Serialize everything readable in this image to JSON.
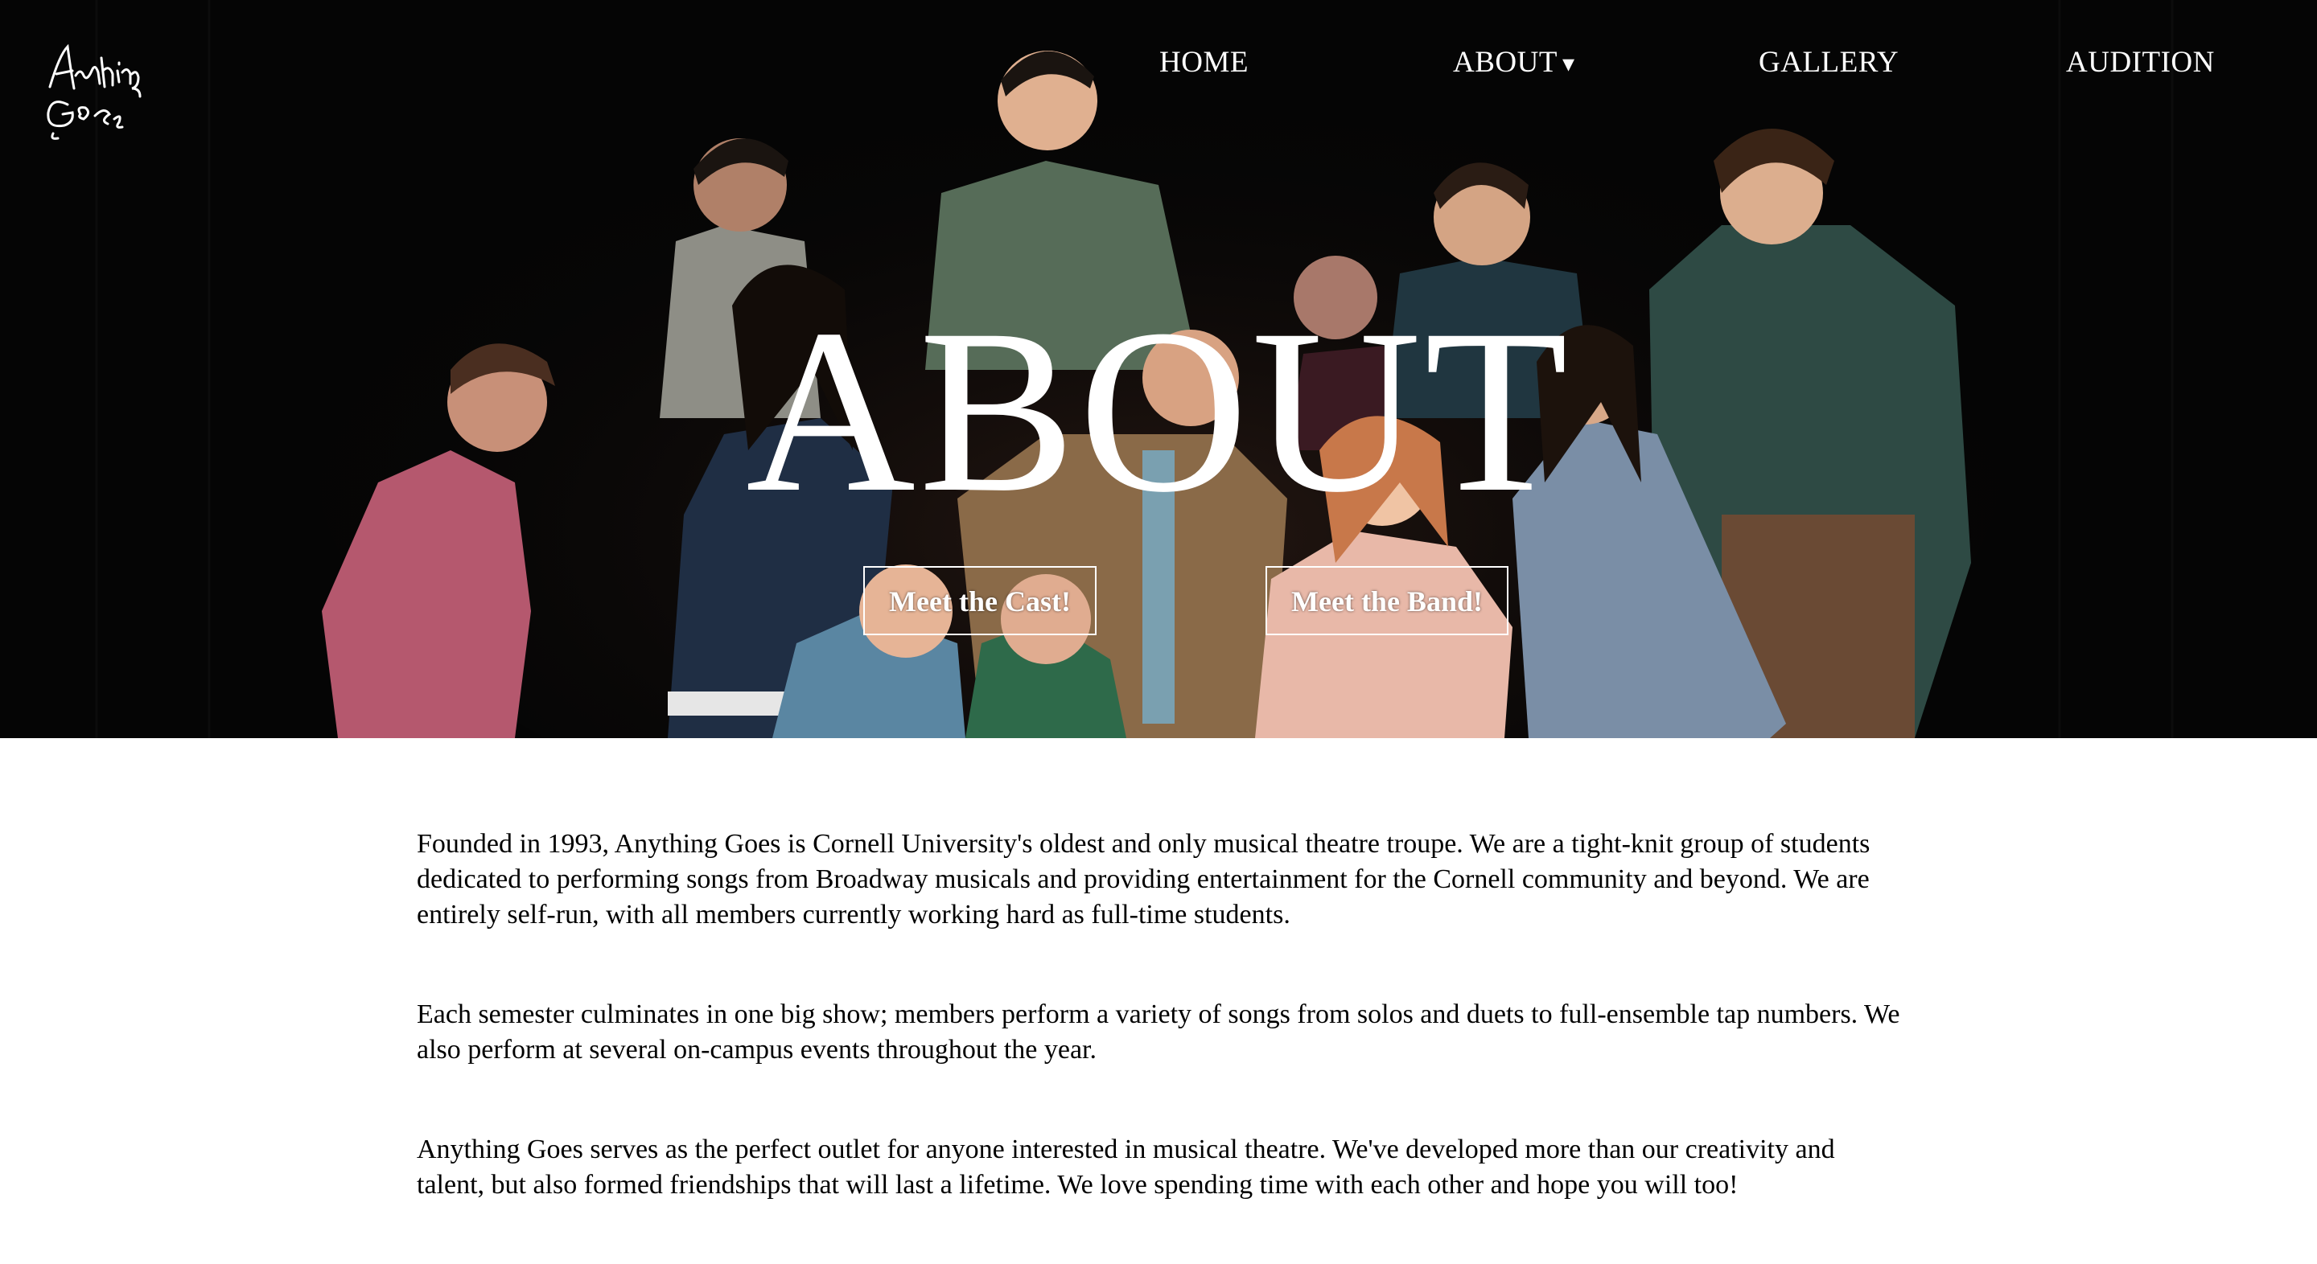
{
  "brand": {
    "logo_text_line1": "Anything",
    "logo_text_line2": "Goes"
  },
  "nav": {
    "items": [
      {
        "label": "HOME"
      },
      {
        "label": "ABOUT"
      },
      {
        "label": "GALLERY"
      },
      {
        "label": "AUDITION"
      }
    ],
    "about_caret": "▾"
  },
  "hero": {
    "title": "ABOUT",
    "buttons": [
      {
        "label": "Meet the Cast!"
      },
      {
        "label": "Meet the Band!"
      }
    ],
    "background_color": "#050505"
  },
  "content": {
    "paragraphs": [
      "Founded in 1993, Anything Goes is Cornell University's oldest and only musical theatre troupe. We are a tight-knit group of students dedicated to performing songs from Broadway musicals and providing entertainment for the Cornell community and beyond. We are entirely self-run, with all members currently working hard as full-time students.",
      "Each semester culminates in one big show; members perform a variety of songs from solos and duets to full-ensemble tap numbers. We also perform at several on-campus events throughout the year.",
      "Anything Goes serves as the perfect outlet for anyone interested in musical theatre. We've developed more than our creativity and talent, but also formed friendships that will last a lifetime. We love spending time with each other and hope you will too!"
    ]
  }
}
